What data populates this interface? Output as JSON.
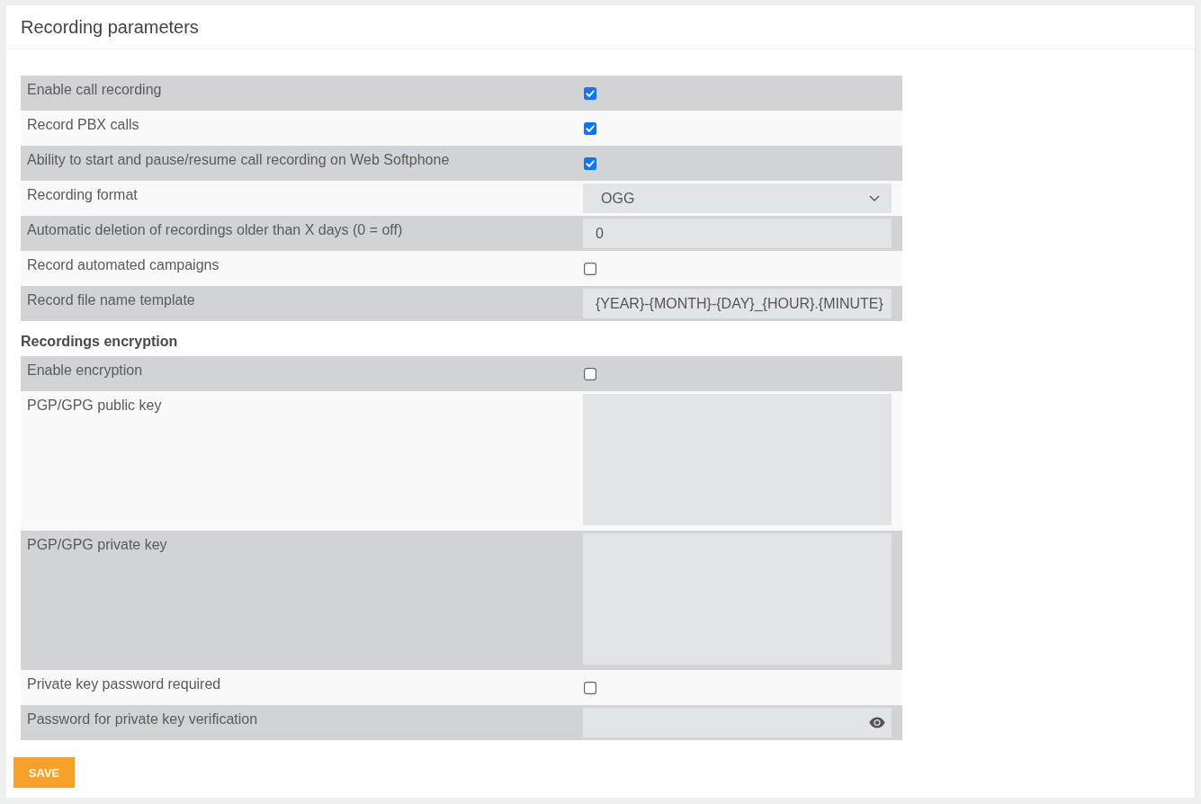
{
  "panel": {
    "title": "Recording parameters"
  },
  "sections": [
    {
      "rows": [
        {
          "label": "Enable call recording",
          "kind": "checkbox",
          "checked": true
        },
        {
          "label": "Record PBX calls",
          "kind": "checkbox",
          "checked": true
        },
        {
          "label": "Ability to start and pause/resume call recording on Web Softphone",
          "kind": "checkbox",
          "checked": true
        },
        {
          "label": "Recording format",
          "kind": "select",
          "value": "OGG"
        },
        {
          "label": "Automatic deletion of recordings older than X days (0 = off)",
          "kind": "text",
          "value": "0"
        },
        {
          "label": "Record automated campaigns",
          "kind": "checkbox",
          "checked": false
        },
        {
          "label": "Record file name template",
          "kind": "text",
          "value": "{YEAR}-{MONTH}-{DAY}_{HOUR}.{MINUTE}"
        }
      ]
    },
    {
      "heading": "Recordings encryption",
      "rows": [
        {
          "label": "Enable encryption",
          "kind": "checkbox",
          "checked": false
        },
        {
          "label": "PGP/GPG public key",
          "kind": "textarea"
        },
        {
          "label": "PGP/GPG private key",
          "kind": "textarea"
        },
        {
          "label": "Private key password required",
          "kind": "checkbox",
          "checked": false
        },
        {
          "label": "Password for private key verification",
          "kind": "password"
        }
      ]
    }
  ],
  "save_button": "SAVE"
}
